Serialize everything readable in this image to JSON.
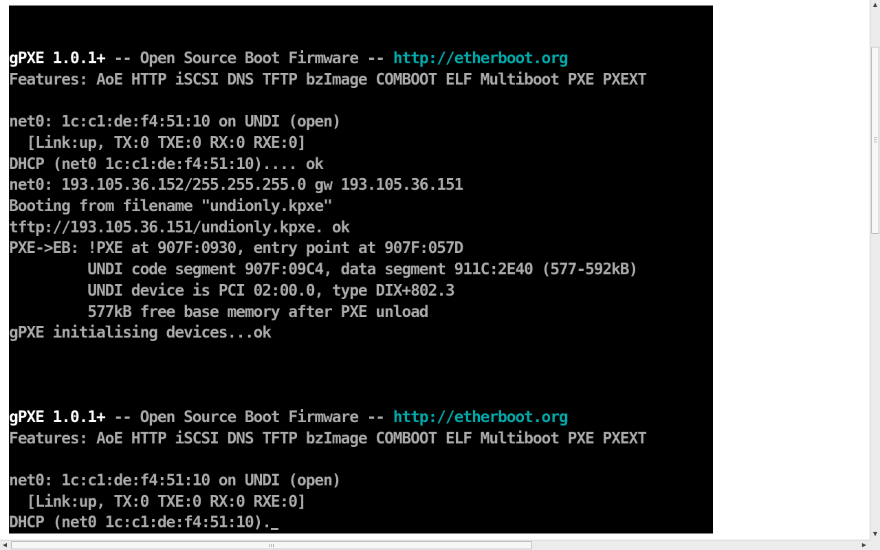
{
  "console": {
    "block1": {
      "banner_product": "gPXE 1.0.1+",
      "banner_middle": " -- Open Source Boot Firmware -- ",
      "banner_url": "http://etherboot.org",
      "features": "Features: AoE HTTP iSCSI DNS TFTP bzImage COMBOOT ELF Multiboot PXE PXEXT",
      "net_open": "net0: 1c:c1:de:f4:51:10 on UNDI (open)",
      "link_status": "  [Link:up, TX:0 TXE:0 RX:0 RXE:0]",
      "dhcp": "DHCP (net0 1c:c1:de:f4:51:10).... ok",
      "net_addr": "net0: 193.105.36.152/255.255.255.0 gw 193.105.36.151",
      "booting": "Booting from filename \"undionly.kpxe\"",
      "tftp": "tftp://193.105.36.151/undionly.kpxe. ok",
      "pxe_eb": "PXE->EB: !PXE at 907F:0930, entry point at 907F:057D",
      "undi_code": "         UNDI code segment 907F:09C4, data segment 911C:2E40 (577-592kB)",
      "undi_device": "         UNDI device is PCI 02:00.0, type DIX+802.3",
      "free_mem": "         577kB free base memory after PXE unload",
      "init": "gPXE initialising devices...ok"
    },
    "block2": {
      "banner_product": "gPXE 1.0.1+",
      "banner_middle": " -- Open Source Boot Firmware -- ",
      "banner_url": "http://etherboot.org",
      "features": "Features: AoE HTTP iSCSI DNS TFTP bzImage COMBOOT ELF Multiboot PXE PXEXT",
      "net_open": "net0: 1c:c1:de:f4:51:10 on UNDI (open)",
      "link_status": "  [Link:up, TX:0 TXE:0 RX:0 RXE:0]",
      "dhcp": "DHCP (net0 1c:c1:de:f4:51:10)."
    }
  },
  "colors": {
    "console_bg": "#000000",
    "text_gray": "#aaaaaa",
    "text_white": "#ffffff",
    "link_cyan": "#00aaaa"
  },
  "icons": {
    "scroll_up": "scroll-up-arrow-icon",
    "scroll_down": "scroll-down-arrow-icon",
    "scroll_left": "scroll-left-arrow-icon",
    "scroll_right": "scroll-right-arrow-icon"
  },
  "glyphs": {
    "up": "▲",
    "down": "▼",
    "left": "◀",
    "right": "▶"
  }
}
